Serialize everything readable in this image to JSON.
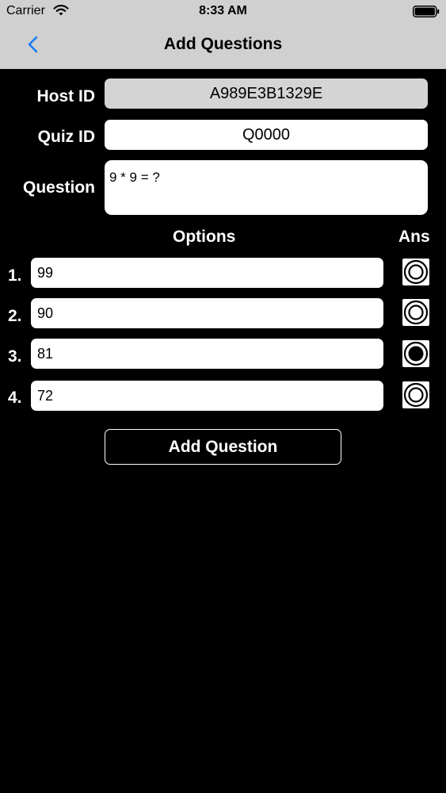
{
  "status_bar": {
    "carrier": "Carrier",
    "time": "8:33 AM"
  },
  "nav": {
    "title": "Add Questions",
    "back_icon": "chevron-left-icon",
    "accent": "#1a7cf5"
  },
  "form": {
    "host_id": {
      "label": "Host ID",
      "value": "A989E3B1329E"
    },
    "quiz_id": {
      "label": "Quiz ID",
      "value": "Q0000"
    },
    "question": {
      "label": "Question",
      "value": "9 * 9 = ?"
    }
  },
  "options_header": "Options",
  "answer_header": "Ans",
  "options": [
    {
      "number": "1.",
      "value": "99",
      "selected": false
    },
    {
      "number": "2.",
      "value": "90",
      "selected": false
    },
    {
      "number": "3.",
      "value": "81",
      "selected": true
    },
    {
      "number": "4.",
      "value": "72",
      "selected": false
    }
  ],
  "add_button": "Add Question"
}
